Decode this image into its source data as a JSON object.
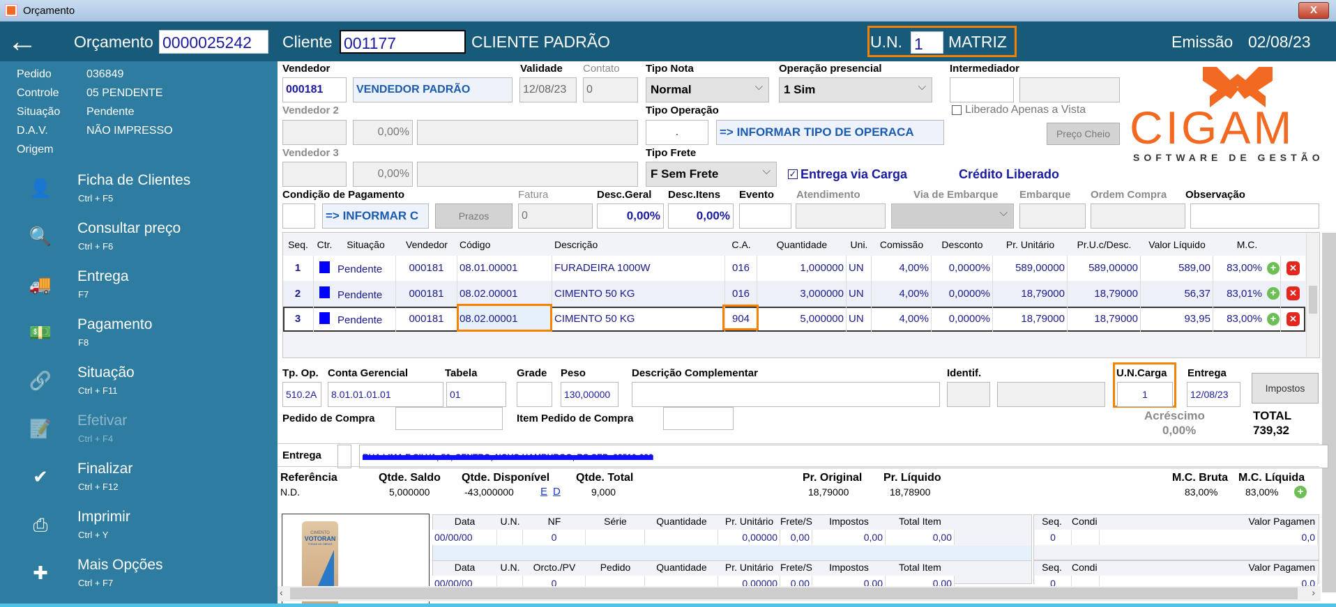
{
  "window": {
    "title": "Orçamento",
    "close": "X"
  },
  "header": {
    "orcamento_label": "Orçamento",
    "orcamento": "0000025242",
    "cliente_label": "Cliente",
    "cliente_code": "001177",
    "cliente_name": "CLIENTE PADRÃO",
    "un_label": "U.N.",
    "un_value": "1",
    "un_name": "MATRIZ",
    "emissao_label": "Emissão",
    "emissao": "02/08/23"
  },
  "sidebar": {
    "info": [
      {
        "label": "Pedido",
        "value": "036849"
      },
      {
        "label": "Controle",
        "value": "05   PENDENTE"
      },
      {
        "label": "Situação",
        "value": "Pendente"
      },
      {
        "label": "D.A.V.",
        "value": "NÃO IMPRESSO"
      },
      {
        "label": "Origem",
        "value": ""
      }
    ],
    "menu": [
      {
        "label": "Ficha de Clientes",
        "shortcut": "Ctrl + F5",
        "icon": "user-icon"
      },
      {
        "label": "Consultar preço",
        "shortcut": "Ctrl + F6",
        "icon": "price-search-icon"
      },
      {
        "label": "Entrega",
        "shortcut": "F7",
        "icon": "truck-icon"
      },
      {
        "label": "Pagamento",
        "shortcut": "F8",
        "icon": "money-icon"
      },
      {
        "label": "Situação",
        "shortcut": "Ctrl + F11",
        "icon": "link-icon"
      },
      {
        "label": "Efetivar",
        "shortcut": "Ctrl + F4",
        "icon": "document-check-icon"
      },
      {
        "label": "Finalizar",
        "shortcut": "Ctrl + F12",
        "icon": "check-icon"
      },
      {
        "label": "Imprimir",
        "shortcut": "Ctrl + Y",
        "icon": "printer-icon"
      },
      {
        "label": "Mais Opções",
        "shortcut": "Ctrl + F7",
        "icon": "plus-icon"
      }
    ]
  },
  "form": {
    "vendedor_label": "Vendedor",
    "vendedor_code": "000181",
    "vendedor_name": "VENDEDOR PADRÃO",
    "validade_label": "Validade",
    "validade": "12/08/23",
    "contato_label": "Contato",
    "contato": "0",
    "tipo_nota_label": "Tipo Nota",
    "tipo_nota": "Normal",
    "op_presencial_label": "Operação presencial",
    "op_presencial": "1 Sim",
    "intermediador_label": "Intermediador",
    "vendedor2_label": "Vendedor 2",
    "vendedor2_pct": "0,00%",
    "vendedor3_label": "Vendedor 3",
    "vendedor3_pct": "0,00%",
    "tipo_operacao_label": "Tipo Operação",
    "tipo_operacao_code": ".",
    "tipo_operacao": "=> INFORMAR TIPO DE OPERACA",
    "liberado_vista": "Liberado Apenas a Vista",
    "preco_cheio": "Preço Cheio",
    "tipo_frete_label": "Tipo Frete",
    "tipo_frete": "F Sem Frete",
    "entrega_carga": "Entrega via Carga",
    "credito": "Crédito Liberado",
    "cond_pag_label": "Condição de Pagamento",
    "cond_pag": "=> INFORMAR C",
    "prazos": "Prazos",
    "fatura_label": "Fatura",
    "fatura": "0",
    "desc_geral_label": "Desc.Geral",
    "desc_geral": "0,00%",
    "desc_itens_label": "Desc.Itens",
    "desc_itens": "0,00%",
    "evento_label": "Evento",
    "atendimento_label": "Atendimento",
    "via_embarque_label": "Via de Embarque",
    "embarque_label": "Embarque",
    "ordem_compra_label": "Ordem Compra",
    "observacao_label": "Observação",
    "logo_text": "CIGAM",
    "logo_sub": "SOFTWARE DE GESTÃO"
  },
  "grid": {
    "columns": [
      "Seq.",
      "Ctr.",
      "Situação",
      "Vendedor",
      "Código",
      "Descrição",
      "C.A.",
      "Quantidade",
      "Uni.",
      "Comissão",
      "Desconto",
      "Pr. Unitário",
      "Pr.U.c/Desc.",
      "Valor Líquido",
      "M.C."
    ],
    "rows": [
      {
        "seq": "1",
        "situacao": "Pendente",
        "vendedor": "000181",
        "codigo": "08.01.00001",
        "descricao": "FURADEIRA 1000W",
        "ca": "016",
        "quantidade": "1,000000",
        "uni": "UN",
        "comissao": "4,00%",
        "desconto": "0,0000%",
        "pr_unitario": "589,00000",
        "pr_desc": "589,00000",
        "valor_liquido": "589,00",
        "mc": "83,00%"
      },
      {
        "seq": "2",
        "situacao": "Pendente",
        "vendedor": "000181",
        "codigo": "08.02.00001",
        "descricao": "CIMENTO 50 KG",
        "ca": "016",
        "quantidade": "3,000000",
        "uni": "UN",
        "comissao": "4,00%",
        "desconto": "0,0000%",
        "pr_unitario": "18,79000",
        "pr_desc": "18,79000",
        "valor_liquido": "56,37",
        "mc": "83,01%"
      },
      {
        "seq": "3",
        "situacao": "Pendente",
        "vendedor": "000181",
        "codigo": "08.02.00001",
        "descricao": "CIMENTO 50 KG",
        "ca": "904",
        "quantidade": "5,000000",
        "uni": "UN",
        "comissao": "4,00%",
        "desconto": "0,0000%",
        "pr_unitario": "18,79000",
        "pr_desc": "18,79000",
        "valor_liquido": "93,95",
        "mc": "83,00%"
      }
    ]
  },
  "item": {
    "tp_op_label": "Tp. Op.",
    "tp_op": "510.2A",
    "conta_label": "Conta Gerencial",
    "conta": "8.01.01.01.01",
    "tabela_label": "Tabela",
    "tabela": "01",
    "grade_label": "Grade",
    "peso_label": "Peso",
    "peso": "130,00000",
    "desc_comp_label": "Descrição Complementar",
    "identif_label": "Identif.",
    "un_carga_label": "U.N.Carga",
    "un_carga": "1",
    "entrega_label": "Entrega",
    "entrega": "12/08/23",
    "impostos": "Impostos",
    "pedido_compra_label": "Pedido de Compra",
    "item_pedido_label": "Item Pedido de Compra",
    "acrescimo_label": "Acréscimo",
    "acrescimo": "0,00%",
    "total_label": "TOTAL",
    "total": "739,32",
    "endereco_label": "Entrega",
    "endereco": "RUA LIMA E SILVA, 50, CENTRO, NOVO HAMBURGO, RS CEP: 93510-000"
  },
  "stock": {
    "referencia_label": "Referência",
    "referencia": "N.D.",
    "saldo_label": "Qtde. Saldo",
    "saldo": "5,000000",
    "disp_label": "Qtde. Disponível",
    "disp": "-43,000000",
    "e": "E",
    "d": "D",
    "total_label": "Qtde. Total",
    "total": "9,000",
    "pr_original_label": "Pr. Original",
    "pr_original": "18,79000",
    "pr_liquido_label": "Pr. Líquido",
    "pr_liquido": "18,78900",
    "mc_bruta_label": "M.C. Bruta",
    "mc_bruta": "83,00%",
    "mc_liquida_label": "M.C. Líquida",
    "mc_liquida": "83,00%"
  },
  "product_image": {
    "brand": "VOTORAN",
    "sub": "CIMENTO",
    "tag": "TODAS AS OBRAS"
  },
  "history": {
    "a_cols": [
      "Data",
      "U.N.",
      "NF",
      "Série",
      "Quantidade",
      "Pr. Unitário",
      "Frete/Seguro",
      "Impostos",
      "Total Item"
    ],
    "a_row": [
      "00/00/00",
      "",
      "0",
      "",
      "",
      "0,00000",
      "0,00",
      "0,00",
      "0,00"
    ],
    "b_cols": [
      "Data",
      "U.N.",
      "Orcto./PV",
      "Pedido",
      "Quantidade",
      "Pr. Unitário",
      "Frete/Seguro",
      "Impostos",
      "Total Item"
    ],
    "b_row": [
      "00/00/00",
      "",
      "0",
      "",
      "",
      "0,00000",
      "0,00",
      "0,00",
      "0,00"
    ],
    "p_cols": [
      "Seq.",
      "Condição de Pagamento",
      "Valor Pagamen"
    ],
    "p_row": [
      "0",
      "",
      "0,0"
    ]
  }
}
